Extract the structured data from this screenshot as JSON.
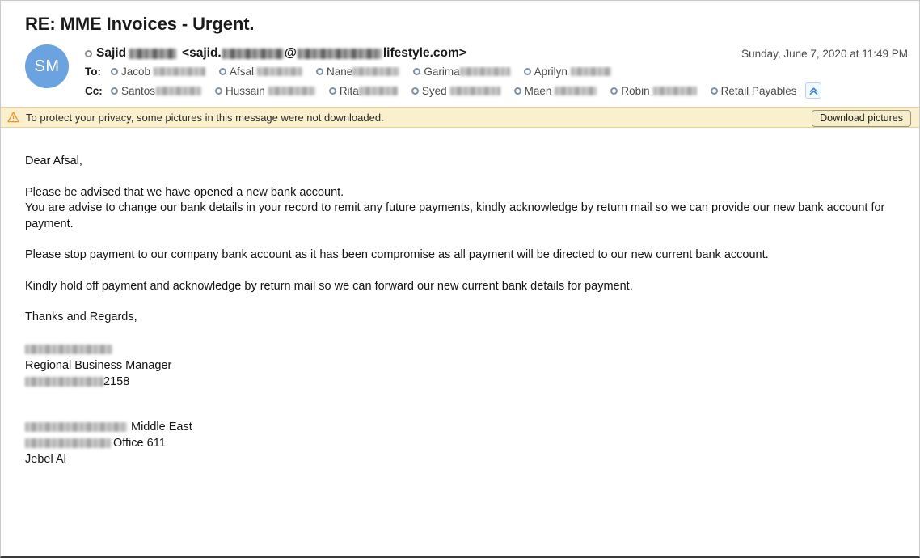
{
  "email": {
    "subject": "RE: MME Invoices - Urgent.",
    "avatar_initials": "SM",
    "sender_name": "Sajid",
    "sender_address_prefix": "<sajid.",
    "sender_address_at": "@",
    "sender_address_suffix": "lifestyle.com>",
    "date": "Sunday, June 7, 2020 at 11:49 PM",
    "to_label": "To:",
    "cc_label": "Cc:",
    "to_recipients": [
      {
        "name": "Jacob",
        "redacted": true
      },
      {
        "name": "Afsal",
        "redacted": true
      },
      {
        "name": "Nane",
        "redacted": true
      },
      {
        "name": "Garima",
        "redacted": true
      },
      {
        "name": "Aprilyn",
        "redacted": true
      }
    ],
    "cc_recipients": [
      {
        "name": "Santos",
        "redacted": true
      },
      {
        "name": "Hussain",
        "redacted": true
      },
      {
        "name": "Rita",
        "redacted": true
      },
      {
        "name": "Syed",
        "redacted": true
      },
      {
        "name": "Maen",
        "redacted": true
      },
      {
        "name": "Robin",
        "redacted": true
      },
      {
        "name": "Retail Payables",
        "redacted": false
      }
    ],
    "collapse_icon": "chevron-double-up-icon"
  },
  "banner": {
    "warning_icon": "warning-triangle-icon",
    "text": "To protect your privacy, some pictures in this message were not downloaded.",
    "button_label": "Download pictures"
  },
  "body": {
    "greeting": "Dear Afsal,",
    "paragraph_1_line_1": "Please be advised that we have opened a new bank account.",
    "paragraph_1_line_2": "You are advise to change our bank details in your record to remit any future payments, kindly acknowledge by return mail so we can provide our new bank account for payment.",
    "paragraph_2": "Please stop payment to our company bank account as it has been compromise as all payment will be directed to our new current bank account.",
    "paragraph_3": "Kindly hold off payment and acknowledge by return mail so we can forward our new current bank details for payment.",
    "closing": "Thanks and Regards,"
  },
  "signature": {
    "name_redacted": true,
    "title": "Regional Business Manager",
    "phone_suffix": "2158",
    "company_suffix": "Middle East",
    "office": "Office 611",
    "location": "Jebel Al"
  },
  "colors": {
    "avatar_bg": "#6aa3e0",
    "banner_bg": "#fbf0cd",
    "banner_border": "#e3d29b",
    "warning_orange": "#e8942a",
    "presence_ring": "#7e8fa0",
    "chevron_blue": "#4a90d9"
  }
}
